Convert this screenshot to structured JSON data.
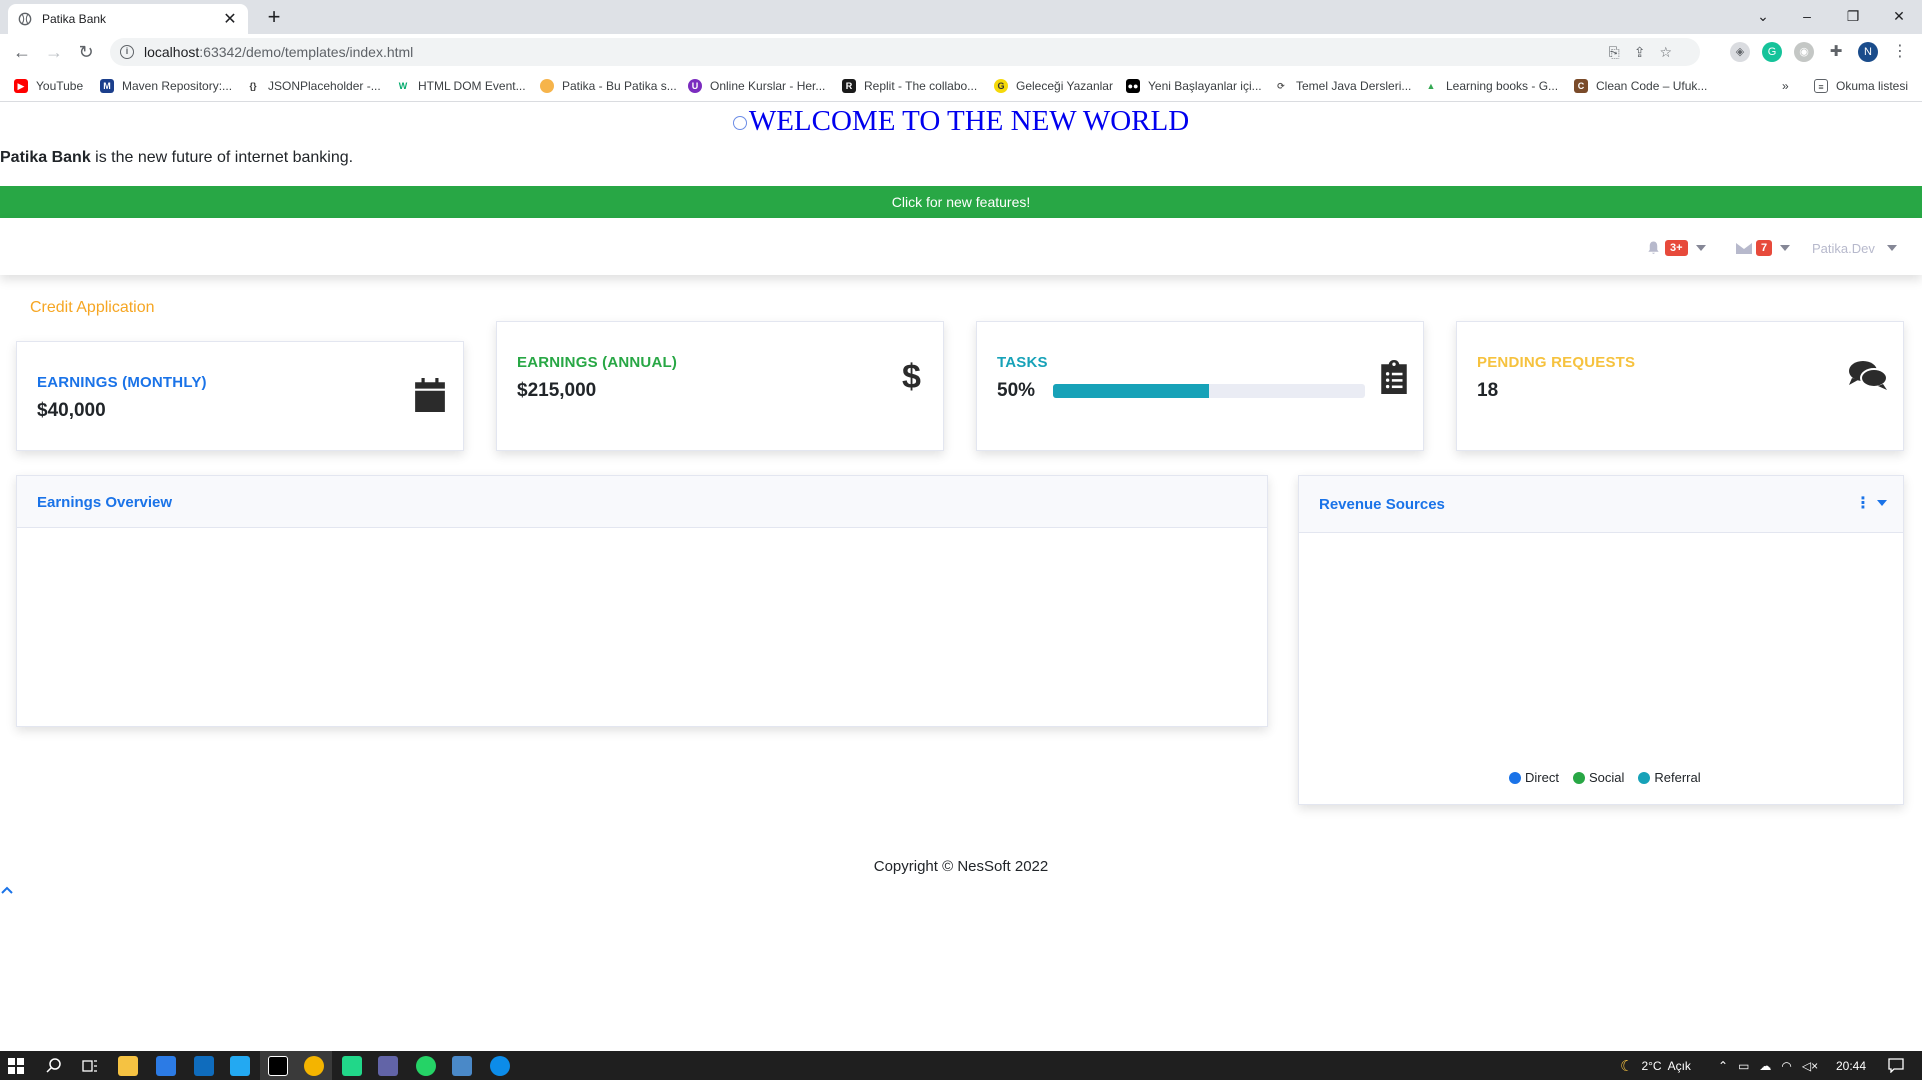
{
  "browser": {
    "tab_title": "Patika Bank",
    "url_host": "localhost",
    "url_path": ":63342/demo/templates/index.html",
    "profile_initial": "N",
    "bookmarks": [
      "YouTube",
      "Maven Repository:...",
      "JSONPlaceholder -...",
      "HTML DOM Event...",
      "Patika - Bu Patika s...",
      "Online Kurslar - Her...",
      "Replit - The collabo...",
      "Geleceği Yazanlar",
      "Yeni Başlayanlar içi...",
      "Temel Java Dersleri...",
      "Learning books - G...",
      "Clean Code – Ufuk..."
    ],
    "reading_list": "Okuma listesi",
    "more_bookmarks": "»"
  },
  "page": {
    "welcome": "WELCOME TO THE NEW WORLD",
    "intro_brand": "Patika Bank",
    "intro_text": " is the new future of internet banking.",
    "feature_button": "Click for new features!",
    "alerts_badge": "3+",
    "messages_badge": "7",
    "user_name": "Patika.Dev",
    "credit_link": "Credit Application",
    "cards": {
      "earnings_monthly": {
        "title": "EARNINGS (MONTHLY)",
        "value": "$40,000",
        "color": "#1a73e8"
      },
      "earnings_annual": {
        "title": "EARNINGS (ANNUAL)",
        "value": "$215,000",
        "color": "#28a745"
      },
      "tasks": {
        "title": "TASKS",
        "value": "50%",
        "progress": 0.5,
        "color": "#17a2b8"
      },
      "pending": {
        "title": "PENDING REQUESTS",
        "value": "18",
        "color": "#f6c23e"
      }
    },
    "earnings_overview_title": "Earnings Overview",
    "revenue_sources_title": "Revenue Sources",
    "legend": [
      {
        "label": "Direct",
        "color": "#1a73e8"
      },
      {
        "label": "Social",
        "color": "#28a745"
      },
      {
        "label": "Referral",
        "color": "#17a2b8"
      }
    ],
    "copyright": "Copyright © NesSoft 2022"
  },
  "taskbar": {
    "temperature": "2°C",
    "weather": "Açık",
    "time": "20:44"
  }
}
